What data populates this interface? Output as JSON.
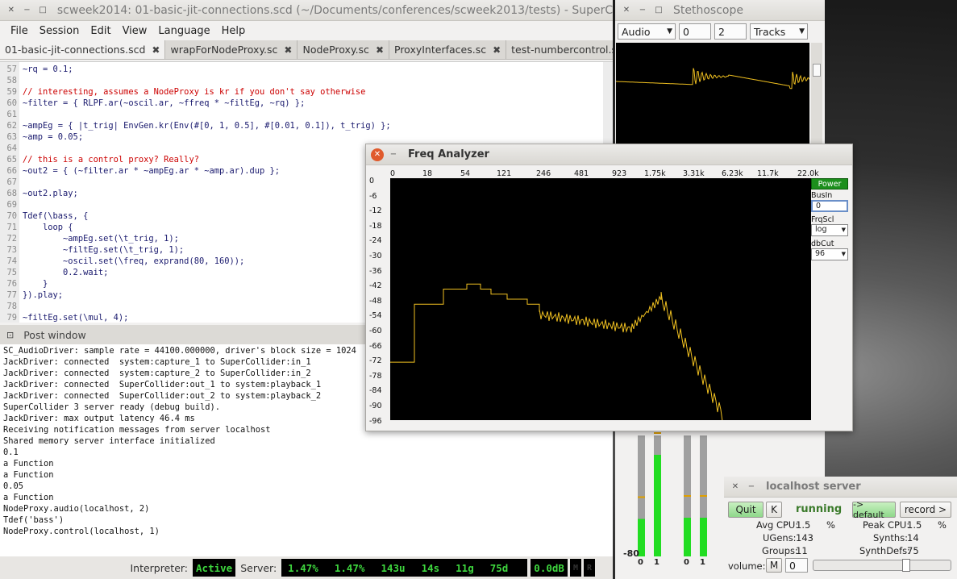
{
  "ide": {
    "title": "scweek2014: 01-basic-jit-connections.scd (~/Documents/conferences/scweek2013/tests) - SuperColl",
    "menu": [
      "File",
      "Session",
      "Edit",
      "View",
      "Language",
      "Help"
    ],
    "tabs": [
      "01-basic-jit-connections.scd",
      "wrapForNodeProxy.sc",
      "NodeProxy.sc",
      "ProxyInterfaces.sc",
      "test-numbercontrol.sc"
    ],
    "line_numbers": [
      "57",
      "58",
      "59",
      "60",
      "61",
      "62",
      "63",
      "64",
      "65",
      "66",
      "67",
      "68",
      "69",
      "70",
      "71",
      "72",
      "73",
      "74",
      "75",
      "76",
      "77",
      "78",
      "79"
    ],
    "code": [
      "~rq = 0.1;",
      "",
      "// interesting, assumes a NodeProxy is kr if you don't say otherwise",
      "~filter = { RLPF.ar(~oscil.ar, ~ffreq * ~filtEg, ~rq) };",
      "",
      "~ampEg = { |t_trig| EnvGen.kr(Env(#[0, 1, 0.5], #[0.01, 0.1]), t_trig) };",
      "~amp = 0.05;",
      "",
      "// this is a control proxy? Really?",
      "~out2 = { (~filter.ar * ~ampEg.ar * ~amp.ar).dup };",
      "",
      "~out2.play;",
      "",
      "Tdef(\\bass, {",
      "    loop {",
      "        ~ampEg.set(\\t_trig, 1);",
      "        ~filtEg.set(\\t_trig, 1);",
      "        ~oscil.set(\\freq, exprand(80, 160));",
      "        0.2.wait;",
      "    }",
      "}).play;",
      "",
      "~filtEg.set(\\mul, 4);"
    ],
    "post_title": "Post window",
    "post_lines": [
      "SC_AudioDriver: sample rate = 44100.000000, driver's block size = 1024",
      "JackDriver: connected  system:capture_1 to SuperCollider:in_1",
      "JackDriver: connected  system:capture_2 to SuperCollider:in_2",
      "JackDriver: connected  SuperCollider:out_1 to system:playback_1",
      "JackDriver: connected  SuperCollider:out_2 to system:playback_2",
      "SuperCollider 3 server ready (debug build).",
      "JackDriver: max output latency 46.4 ms",
      "Receiving notification messages from server localhost",
      "Shared memory server interface initialized",
      "0.1",
      "a Function",
      "a Function",
      "0.05",
      "a Function",
      "NodeProxy.audio(localhost, 2)",
      "Tdef('bass')",
      "NodeProxy.control(localhost, 1)"
    ],
    "status": {
      "interpreter_label": "Interpreter:",
      "interpreter_state": "Active",
      "server_label": "Server:",
      "avg_cpu": "1.47%",
      "peak_cpu": "1.47%",
      "ugens": "143u",
      "synths": "14s",
      "groups": "11g",
      "synthdefs": "75d",
      "volume": "0.0dB",
      "mute": "M",
      "rec": "R"
    }
  },
  "stethoscope": {
    "title": "Stethoscope",
    "rate": "Audio",
    "offset": "0",
    "channels": "2",
    "mode": "Tracks",
    "meter_labels": [
      "0",
      "1",
      "0",
      "1"
    ],
    "meter_levels": [
      0.31,
      0.84,
      0.32,
      0.32
    ],
    "meter_db_label": "-80"
  },
  "freq_analyzer": {
    "title": "Freq Analyzer",
    "x_ticks": [
      "0",
      "18",
      "54",
      "121",
      "246",
      "481",
      "923",
      "1.75k",
      "3.31k",
      "6.23k",
      "11.7k",
      "22.0k"
    ],
    "y_ticks": [
      "0",
      "-6",
      "-12",
      "-18",
      "-24",
      "-30",
      "-36",
      "-42",
      "-48",
      "-54",
      "-60",
      "-66",
      "-72",
      "-78",
      "-84",
      "-90",
      "-96"
    ],
    "power_label": "Power",
    "busin_label": "BusIn",
    "busin_value": "0",
    "frqscl_label": "FrqScl",
    "frqscl_value": "log",
    "dbcut_label": "dbCut",
    "dbcut_value": "96",
    "curve_color": "#f0c020"
  },
  "server": {
    "title": "localhost server",
    "quit": "Quit",
    "kill": "K",
    "state": "running",
    "default_btn": "-> default",
    "record_btn": "record >",
    "avg_cpu_label": "Avg CPU:",
    "avg_cpu": "1.5",
    "peak_cpu_label": "Peak CPU:",
    "peak_cpu": "1.5",
    "pct": "%",
    "ugens_label": "UGens:",
    "ugens": "143",
    "synths_label": "Synths:",
    "synths": "14",
    "groups_label": "Groups:",
    "groups": "11",
    "synthdefs_label": "SynthDefs:",
    "synthdefs": "75",
    "volume_label": "volume:",
    "mute": "M",
    "volume": "0",
    "running_color": "#3a7a2a"
  }
}
